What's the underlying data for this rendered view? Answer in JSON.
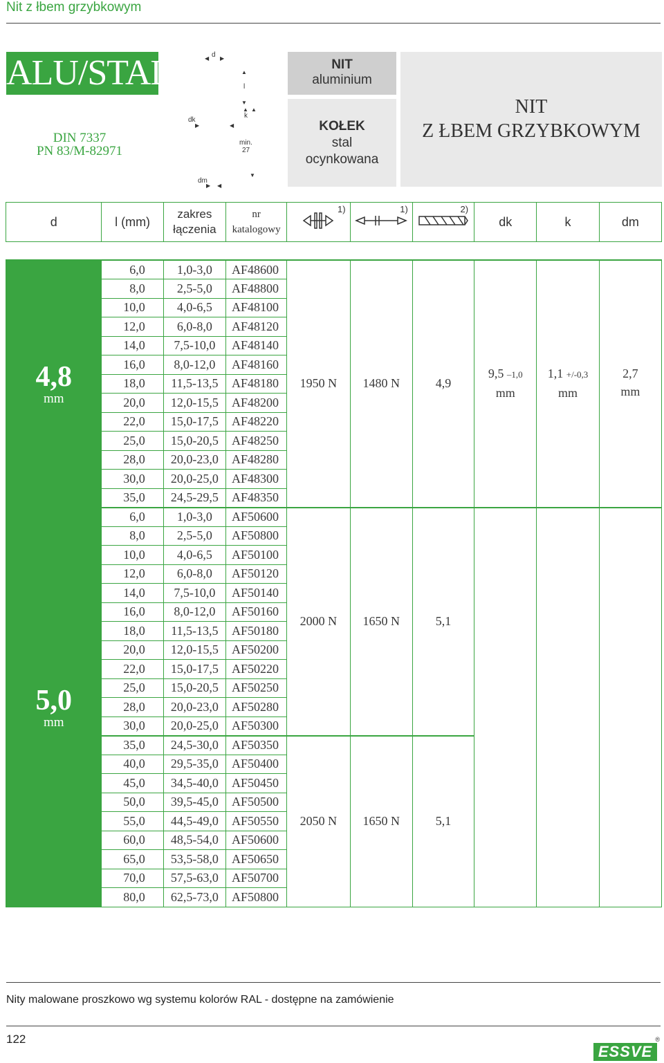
{
  "page": {
    "title": "Nit z łbem grzybkowym",
    "alu_label": "ALU/STAL",
    "standard_1": "DIN 7337",
    "standard_2": "PN 83/M-82971"
  },
  "diagram": {
    "d": "d",
    "l": "l",
    "k": "k",
    "dk": "dk",
    "dm": "dm",
    "min_label": "min.",
    "min_value": "27"
  },
  "material": {
    "nit_title": "NIT",
    "nit_material": "aluminium",
    "kolek_title": "KOŁEK",
    "kolek_line1": "stal",
    "kolek_line2": "ocynkowana",
    "product_line1": "NIT",
    "product_line2": "Z ŁBEM GRZYBKOWYM"
  },
  "columns": {
    "d": "d",
    "l": "l (mm)",
    "zakres_1": "zakres",
    "zakres_2": "łączenia",
    "nr_1": "nr",
    "nr_2": "katalogowy",
    "shear_note": "1)",
    "tensile_note": "1)",
    "drill_note": "2)",
    "dk": "dk",
    "k": "k",
    "dm": "dm"
  },
  "groups": [
    {
      "d": "4,8",
      "unit": "mm",
      "shear": "1950 N",
      "tensile": "1480 N",
      "drill": "4,9",
      "dk": "9,5",
      "dk_tol": "–1,0",
      "k": "1,1",
      "k_tol": "+/-0,3",
      "dm": "2,7",
      "spec_unit": "mm",
      "rows": [
        [
          "6,0",
          "1,0-3,0",
          "AF48600"
        ],
        [
          "8,0",
          "2,5-5,0",
          "AF48800"
        ],
        [
          "10,0",
          "4,0-6,5",
          "AF48100"
        ],
        [
          "12,0",
          "6,0-8,0",
          "AF48120"
        ],
        [
          "14,0",
          "7,5-10,0",
          "AF48140"
        ],
        [
          "16,0",
          "8,0-12,0",
          "AF48160"
        ],
        [
          "18,0",
          "11,5-13,5",
          "AF48180"
        ],
        [
          "20,0",
          "12,0-15,5",
          "AF48200"
        ],
        [
          "22,0",
          "15,0-17,5",
          "AF48220"
        ],
        [
          "25,0",
          "15,0-20,5",
          "AF48250"
        ],
        [
          "28,0",
          "20,0-23,0",
          "AF48280"
        ],
        [
          "30,0",
          "20,0-25,0",
          "AF48300"
        ],
        [
          "35,0",
          "24,5-29,5",
          "AF48350"
        ]
      ]
    },
    {
      "d": "5,0",
      "unit": "mm",
      "sub": [
        {
          "shear": "2000 N",
          "tensile": "1650 N",
          "drill": "5,1",
          "rows": [
            [
              "6,0",
              "1,0-3,0",
              "AF50600"
            ],
            [
              "8,0",
              "2,5-5,0",
              "AF50800"
            ],
            [
              "10,0",
              "4,0-6,5",
              "AF50100"
            ],
            [
              "12,0",
              "6,0-8,0",
              "AF50120"
            ],
            [
              "14,0",
              "7,5-10,0",
              "AF50140"
            ],
            [
              "16,0",
              "8,0-12,0",
              "AF50160"
            ],
            [
              "18,0",
              "11,5-13,5",
              "AF50180"
            ],
            [
              "20,0",
              "12,0-15,5",
              "AF50200"
            ],
            [
              "22,0",
              "15,0-17,5",
              "AF50220"
            ],
            [
              "25,0",
              "15,0-20,5",
              "AF50250"
            ],
            [
              "28,0",
              "20,0-23,0",
              "AF50280"
            ],
            [
              "30,0",
              "20,0-25,0",
              "AF50300"
            ]
          ]
        },
        {
          "shear": "2050 N",
          "tensile": "1650 N",
          "drill": "5,1",
          "rows": [
            [
              "35,0",
              "24,5-30,0",
              "AF50350"
            ],
            [
              "40,0",
              "29,5-35,0",
              "AF50400"
            ],
            [
              "45,0",
              "34,5-40,0",
              "AF50450"
            ],
            [
              "50,0",
              "39,5-45,0",
              "AF50500"
            ],
            [
              "55,0",
              "44,5-49,0",
              "AF50550"
            ],
            [
              "60,0",
              "48,5-54,0",
              "AF50600"
            ],
            [
              "65,0",
              "53,5-58,0",
              "AF50650"
            ],
            [
              "70,0",
              "57,5-63,0",
              "AF50700"
            ],
            [
              "80,0",
              "62,5-73,0",
              "AF50800"
            ]
          ]
        }
      ]
    }
  ],
  "footer": {
    "note": "Nity malowane proszkowo wg systemu kolorów RAL - dostępne na zamówienie",
    "page_number": "122",
    "logo_text": "ESSVE",
    "logo_reg": "®"
  },
  "colors": {
    "accent": "#3aa541",
    "gray_dark": "#cfcfcf",
    "gray_light": "#e9e9e9"
  }
}
